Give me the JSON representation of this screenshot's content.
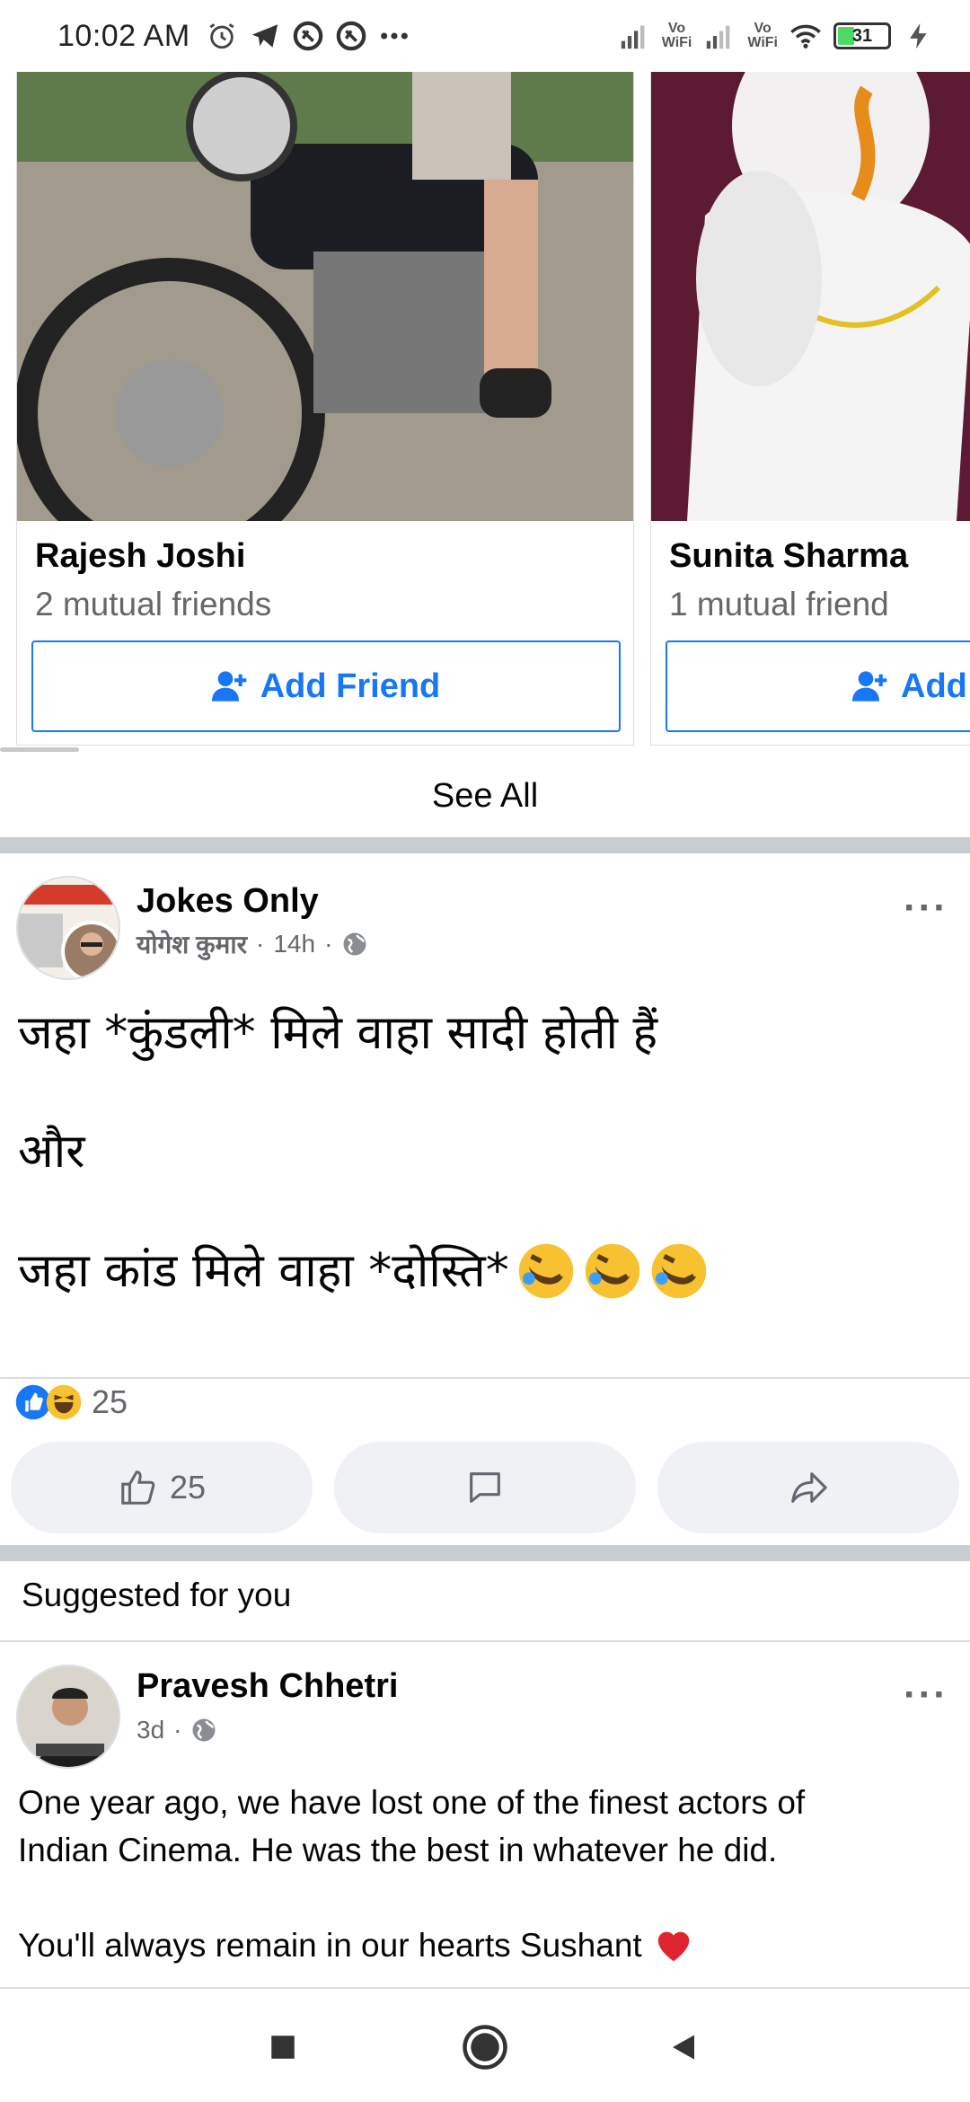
{
  "status_bar": {
    "time": "10:02 AM",
    "left_icons": [
      "alarm-icon",
      "telegram-icon",
      "notification-icon",
      "notification-icon",
      "more-icon"
    ],
    "right_icons": [
      "signal-icon",
      "vowifi-icon",
      "signal-icon",
      "vowifi-icon",
      "wifi-icon",
      "battery-icon",
      "charging-icon"
    ],
    "vowifi_label": "Vo\nWiFi",
    "battery_level": "31"
  },
  "people_you_may_know": {
    "cards": [
      {
        "name": "Rajesh Joshi",
        "mutual": "2 mutual friends",
        "button": "Add Friend"
      },
      {
        "name": "Sunita Sharma",
        "mutual": "1 mutual friend",
        "button": "Add Friend"
      }
    ],
    "see_all": "See All"
  },
  "post1": {
    "page_name": "Jokes Only",
    "author": "योगेश कुमार",
    "time": "14h",
    "privacy_icon": "globe-icon",
    "lines": [
      "जहा *कुंडली* मिले वाहा सादी होती हैं",
      "और",
      "जहा कांड मिले वाहा  *दोस्ति*"
    ],
    "reaction_count": "25",
    "like_count": "25",
    "reactions": [
      "like-icon",
      "haha-icon"
    ]
  },
  "suggested": {
    "label": "Suggested for you"
  },
  "post2": {
    "author": "Pravesh Chhetri",
    "time": "3d",
    "privacy_icon": "globe-icon",
    "text_line1": "One year ago, we have lost one of the finest actors of",
    "text_line2": "Indian Cinema. He was the best in whatever he did.",
    "text_line3": "You'll always remain in our hearts Sushant"
  },
  "nav": {
    "buttons": [
      "recents-button",
      "home-button",
      "back-button"
    ]
  },
  "colors": {
    "accent": "#1877f2",
    "divider": "#c9ccd1",
    "action_bg": "#eff1f4",
    "meta_text": "#65676b"
  }
}
